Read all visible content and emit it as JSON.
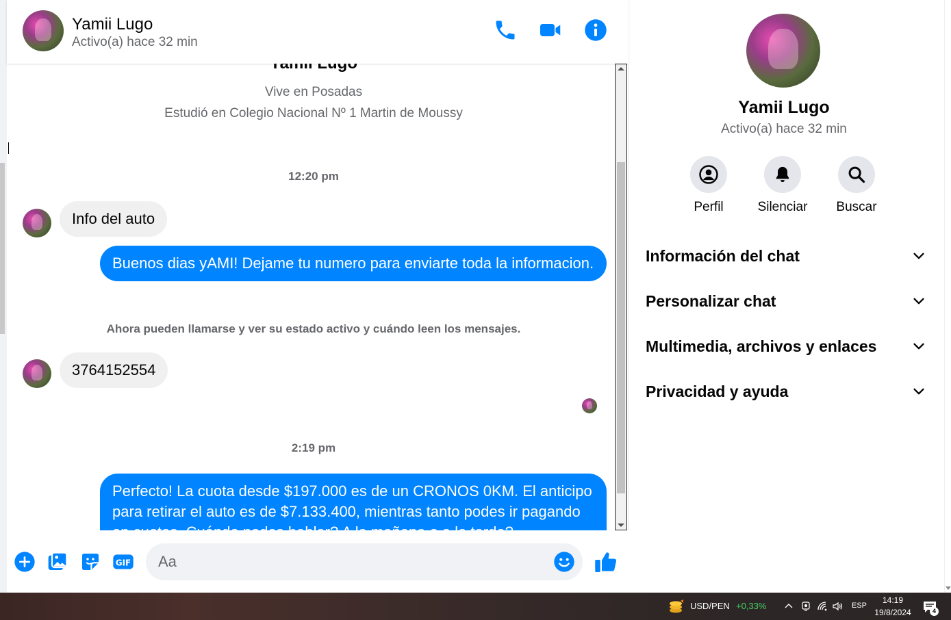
{
  "contact": {
    "name": "Yamii Lugo",
    "status": "Activo(a) hace 32 min"
  },
  "profile_intro": {
    "name": "Yamii Lugo",
    "lives_in": "Vive en Posadas",
    "studied_at": "Estudió en Colegio Nacional Nº 1 Martin de Moussy"
  },
  "conversation": {
    "time_1": "12:20 pm",
    "msg_in_1": "Info del auto",
    "msg_out_1": "Buenos dias yAMI! Dejame tu numero para enviarte toda la informacion.",
    "system_note": "Ahora pueden llamarse y ver su estado activo y cuándo leen los mensajes.",
    "msg_in_2": "3764152554",
    "time_2": "2:19 pm",
    "msg_out_2": "Perfecto! La cuota desde $197.000 es de un CRONOS 0KM. El anticipo para retirar el auto es de $7.133.400, mientras tanto podes ir pagando en cuotas. Cuándo podes hablar? A la mañana o a la tarde?"
  },
  "composer": {
    "placeholder": "Aa"
  },
  "icons": {
    "header": [
      "phone-icon",
      "video-icon",
      "info-icon"
    ],
    "composer": [
      "plus-icon",
      "image-icon",
      "sticker-icon",
      "gif-icon",
      "emoji-icon",
      "like-icon"
    ]
  },
  "panel": {
    "name": "Yamii Lugo",
    "status": "Activo(a) hace 32 min",
    "actions": [
      {
        "label": "Perfil",
        "icon": "profile-icon"
      },
      {
        "label": "Silenciar",
        "icon": "bell-icon"
      },
      {
        "label": "Buscar",
        "icon": "search-icon"
      }
    ],
    "sections": [
      {
        "title": "Información del chat"
      },
      {
        "title": "Personalizar chat"
      },
      {
        "title": "Multimedia, archivos y enlaces"
      },
      {
        "title": "Privacidad y ayuda"
      }
    ]
  },
  "taskbar": {
    "currency_pair": "USD/PEN",
    "currency_change": "+0,33%",
    "language": "ESP",
    "time": "14:19",
    "date": "19/8/2024",
    "notifications": "4"
  },
  "colors": {
    "accent": "#0084ff",
    "incoming_bubble": "#f0f0f0",
    "secondary_text": "#65676b",
    "currency_up": "#44d062"
  }
}
